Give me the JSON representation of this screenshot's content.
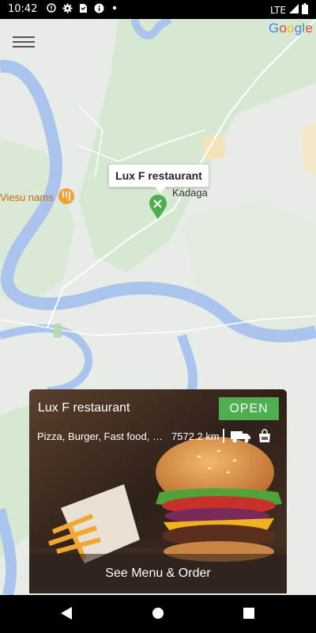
{
  "status_bar": {
    "time": "10:42",
    "network": "LTE"
  },
  "map": {
    "provider": "Google",
    "labels": {
      "poi": "Viesu nams",
      "village": "Kadaga"
    },
    "marker_title": "Lux F restaurant"
  },
  "card": {
    "title": "Lux F restaurant",
    "status": "OPEN",
    "cuisines": "Pizza, Burger, Fast food, Salad",
    "distance": "7572.2 km",
    "cta": "See Menu & Order"
  },
  "icons": {
    "status": [
      "alert-circle-icon",
      "settings-icon",
      "sim-card-icon",
      "info-icon",
      "dot-icon"
    ],
    "signal": [
      "signal-icon",
      "battery-icon"
    ],
    "card": [
      "delivery-truck-icon",
      "shopping-bag-icon"
    ],
    "nav": [
      "back-icon",
      "home-icon",
      "recents-icon"
    ]
  },
  "colors": {
    "open_badge": "#4caf50",
    "marker": "#4caf50",
    "river": "#aac4ee"
  }
}
